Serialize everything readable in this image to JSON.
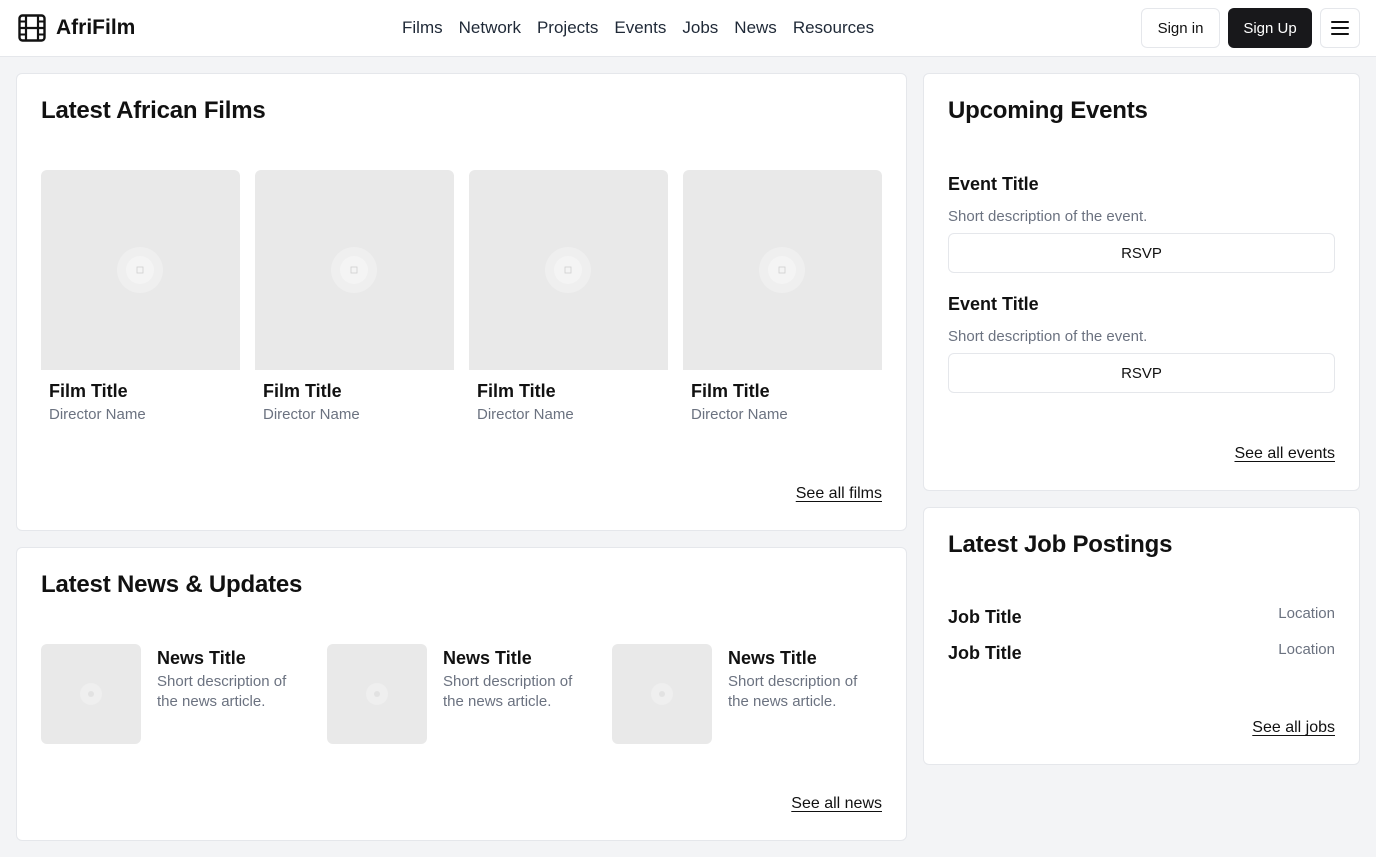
{
  "brand": {
    "name": "AfriFilm",
    "icon": "film-icon"
  },
  "nav": [
    "Films",
    "Network",
    "Projects",
    "Events",
    "Jobs",
    "News",
    "Resources"
  ],
  "auth": {
    "signin": "Sign in",
    "signup": "Sign Up",
    "menu_icon": "hamburger-menu-icon"
  },
  "films": {
    "title": "Latest African Films",
    "items": [
      {
        "title": "Film Title",
        "director": "Director Name"
      },
      {
        "title": "Film Title",
        "director": "Director Name"
      },
      {
        "title": "Film Title",
        "director": "Director Name"
      },
      {
        "title": "Film Title",
        "director": "Director Name"
      }
    ],
    "see_all": "See all films"
  },
  "news": {
    "title": "Latest News & Updates",
    "items": [
      {
        "title": "News Title",
        "description": "Short description of the news article."
      },
      {
        "title": "News Title",
        "description": "Short description of the news article."
      },
      {
        "title": "News Title",
        "description": "Short description of the news article."
      }
    ],
    "see_all": "See all news"
  },
  "events": {
    "title": "Upcoming Events",
    "items": [
      {
        "title": "Event Title",
        "description": "Short description of the event.",
        "button": "RSVP"
      },
      {
        "title": "Event Title",
        "description": "Short description of the event.",
        "button": "RSVP"
      }
    ],
    "see_all": "See all events"
  },
  "jobs": {
    "title": "Latest Job Postings",
    "items": [
      {
        "title": "Job Title",
        "location": "Location"
      },
      {
        "title": "Job Title",
        "location": "Location"
      }
    ],
    "see_all": "See all jobs"
  },
  "colors": {
    "accent": "#18181b",
    "muted": "#6b7280",
    "placeholder": "#e9e9e9",
    "background": "#f3f4f6"
  }
}
